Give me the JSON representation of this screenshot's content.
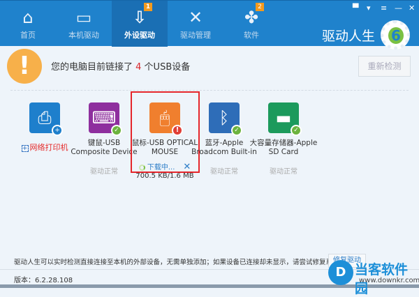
{
  "nav": {
    "tabs": [
      {
        "label": "首页",
        "icon": "home-icon",
        "glyph": "⌂"
      },
      {
        "label": "本机驱动",
        "icon": "monitor-icon",
        "glyph": "▭"
      },
      {
        "label": "外设驱动",
        "icon": "usb-icon",
        "glyph": "⇩",
        "badge": "1",
        "active": true
      },
      {
        "label": "驱动管理",
        "icon": "tools-icon",
        "glyph": "✕"
      },
      {
        "label": "软件",
        "icon": "clover-icon",
        "glyph": "✤",
        "badge": "2"
      }
    ]
  },
  "window_controls": [
    "feedback-icon",
    "skin-icon",
    "menu-icon",
    "minimize-icon",
    "close-icon"
  ],
  "brand": {
    "name": "驱动人生",
    "logo_digit": "6"
  },
  "alert": {
    "prefix": "您的电脑目前链接了 ",
    "count": "4",
    "suffix": " 个USB设备",
    "rescan_label": "重新检测"
  },
  "devices": [
    {
      "kind": "add",
      "name": "网络打印机",
      "color": "#1e7fcc",
      "icon": "printer-icon"
    },
    {
      "name": "键鼠-USB Composite Device",
      "status": "驱动正常",
      "color": "#8e2f9e",
      "icon": "keyboard-mouse-icon"
    },
    {
      "name": "鼠标-USB OPTICAL MOUSE",
      "color": "#f07f2e",
      "icon": "mouse-icon",
      "download_label": "下载中...",
      "progress": "700.5 KB/1.6 MB",
      "progress_fraction": 0.43
    },
    {
      "name": "蓝牙-Apple Broadcom Built-in",
      "status": "驱动正常",
      "color": "#2e6db8",
      "icon": "bluetooth-icon"
    },
    {
      "name": "大容量存储器-Apple SD Card",
      "status": "驱动正常",
      "color": "#1c9a5c",
      "icon": "storage-icon"
    }
  ],
  "footer": {
    "hint": "驱动人生可以实时检测直接连接至本机的外部设备，无需单独添加；如果设备已连接却未显示，请尝试修复系统驱动:",
    "fix_label": "修复驱动",
    "version": "版本：6.2.28.108"
  },
  "watermark": {
    "text": "当客软件园",
    "url": "www.downkr.com"
  }
}
